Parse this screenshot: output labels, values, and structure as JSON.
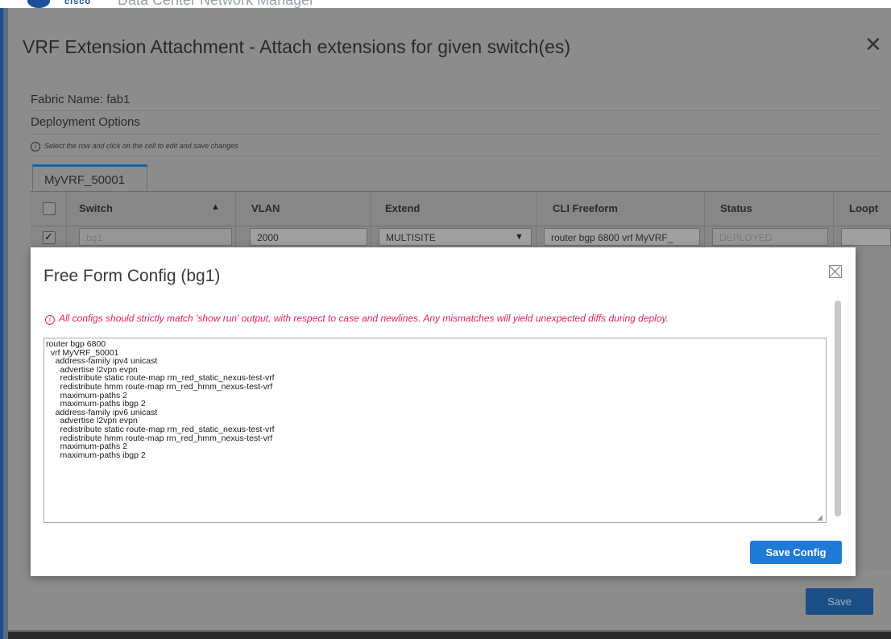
{
  "app": {
    "brand": "cisco",
    "name": "Data Center Network Manager"
  },
  "outer_modal": {
    "title": "VRF Extension Attachment - Attach extensions for given switch(es)",
    "close_glyph": "✕",
    "fabric_label": "Fabric Name: fab1",
    "deployment_label": "Deployment Options",
    "hint": "Select the row and click on the cell to edit and save changes",
    "tab": "MyVRF_50001",
    "save_label": "Save"
  },
  "table": {
    "headers": {
      "switch": "Switch",
      "vlan": "VLAN",
      "extend": "Extend",
      "cli_freeform": "CLI Freeform",
      "status": "Status",
      "loopback": "Loopt"
    },
    "rows": [
      {
        "checked": true,
        "switch": "bg1",
        "vlan": "2000",
        "extend": "MULTISITE",
        "cli_freeform": "router bgp 6800  vrf MyVRF_",
        "status": "DEPLOYED",
        "loopback": ""
      }
    ]
  },
  "free_form": {
    "title": "Free Form Config (bg1)",
    "warning": "All configs should strictly match 'show run' output, with respect to case and newlines. Any mismatches will yield unexpected diffs during deploy.",
    "config_lines": [
      "router bgp 6800",
      "  vrf MyVRF_50001",
      "    address-family ipv4 unicast",
      "      advertise l2vpn evpn",
      "      redistribute static route-map rm_red_static_nexus-test-vrf",
      "      redistribute hmm route-map rm_red_hmm_nexus-test-vrf",
      "      maximum-paths 2",
      "      maximum-paths ibgp 2",
      "    address-family ipv6 unicast",
      "      advertise l2vpn evpn",
      "      redistribute static route-map rm_red_static_nexus-test-vrf",
      "      redistribute hmm route-map rm_red_hmm_nexus-test-vrf",
      "      maximum-paths 2",
      "      maximum-paths ibgp 2"
    ],
    "save_label": "Save Config"
  },
  "colors": {
    "accent": "#1f7ad6",
    "warning": "#e0245e",
    "tab_accent": "#1565a6"
  }
}
